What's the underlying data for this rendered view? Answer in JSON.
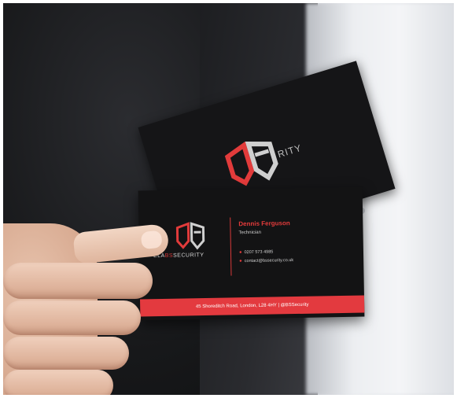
{
  "photo": {
    "subject": "",
    "colors": {
      "accent": "#e33a3f",
      "card": "#131314",
      "suit": "#1c1c1e",
      "shirt": "#eceef1",
      "skin": "#e2b9a2"
    }
  },
  "card_back": {
    "brand_text": "RITY"
  },
  "card_front": {
    "brand_prefix": "ELA",
    "brand_highlight": "BS",
    "brand_suffix": "SECURITY",
    "name": "Dennis Ferguson",
    "role": "Technician",
    "phone": "0207 573 4985",
    "email": "contact@bssecurity.co.uk",
    "address_bar": "45 Shoreditch Road, London, L28 4HY | @BSSecurity"
  }
}
